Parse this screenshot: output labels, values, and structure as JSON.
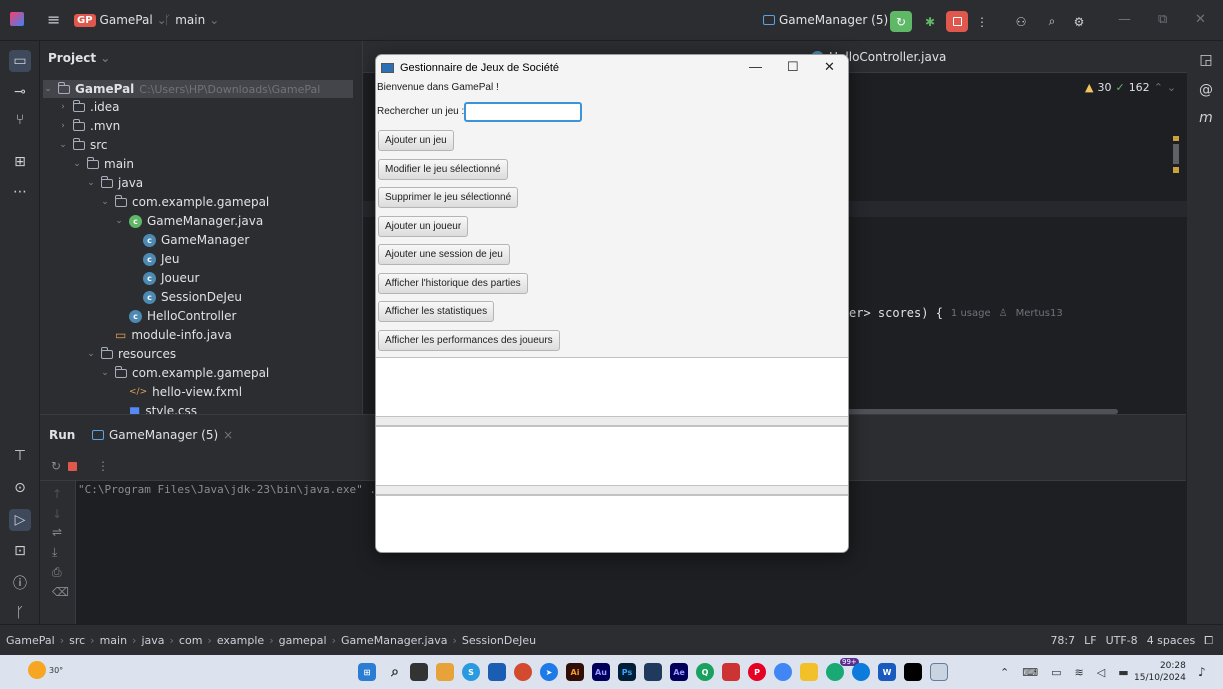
{
  "titlebar": {
    "project_badge": "GP",
    "project_name": "GamePal",
    "branch": "main",
    "run_config": "GameManager (5)"
  },
  "project_panel": {
    "title": "Project",
    "root": {
      "name": "GamePal",
      "path": "C:\\Users\\HP\\Downloads\\GamePal"
    },
    "items": [
      {
        "label": ".idea",
        "kind": "folder",
        "depth": 1,
        "expanded": false
      },
      {
        "label": ".mvn",
        "kind": "folder",
        "depth": 1,
        "expanded": false
      },
      {
        "label": "src",
        "kind": "folder",
        "depth": 1,
        "expanded": true
      },
      {
        "label": "main",
        "kind": "folder",
        "depth": 2,
        "expanded": true
      },
      {
        "label": "java",
        "kind": "folder",
        "depth": 3,
        "expanded": true
      },
      {
        "label": "com.example.gamepal",
        "kind": "package",
        "depth": 4,
        "expanded": true
      },
      {
        "label": "GameManager.java",
        "kind": "javafile",
        "depth": 5,
        "expanded": true
      },
      {
        "label": "GameManager",
        "kind": "class",
        "depth": 6
      },
      {
        "label": "Jeu",
        "kind": "class",
        "depth": 6
      },
      {
        "label": "Joueur",
        "kind": "class",
        "depth": 6
      },
      {
        "label": "SessionDeJeu",
        "kind": "class",
        "depth": 6
      },
      {
        "label": "HelloController",
        "kind": "class",
        "depth": 5
      },
      {
        "label": "module-info.java",
        "kind": "module",
        "depth": 4
      },
      {
        "label": "resources",
        "kind": "resfolder",
        "depth": 3,
        "expanded": true
      },
      {
        "label": "com.example.gamepal",
        "kind": "folder",
        "depth": 4,
        "expanded": true
      },
      {
        "label": "hello-view.fxml",
        "kind": "fxml",
        "depth": 5
      },
      {
        "label": "style.css",
        "kind": "css",
        "depth": 5
      }
    ]
  },
  "editor": {
    "visible_tab": "HelloController.java",
    "warnings": "30",
    "checks": "162",
    "code_fragment": "er> scores) {",
    "usage_hint": "1 usage",
    "author_hint": "Mertus13"
  },
  "run_panel": {
    "label": "Run",
    "tab": "GameManager (5)",
    "console_line": "\"C:\\Program Files\\Java\\jdk-23\\bin\\java.exe\" ..."
  },
  "statusbar": {
    "breadcrumb": [
      "GamePal",
      "src",
      "main",
      "java",
      "com",
      "example",
      "gamepal",
      "GameManager.java",
      "SessionDeJeu"
    ],
    "position": "78:7",
    "line_sep": "LF",
    "encoding": "UTF-8",
    "indent": "4 spaces"
  },
  "dialog": {
    "title": "Gestionnaire de Jeux de Société",
    "welcome": "Bienvenue dans GamePal !",
    "search_label": "Rechercher un jeu :",
    "search_value": "",
    "buttons": [
      "Ajouter un jeu",
      "Modifier le jeu sélectionné",
      "Supprimer le jeu sélectionné",
      "Ajouter un joueur",
      "Ajouter une session de jeu",
      "Afficher l'historique des parties",
      "Afficher les statistiques",
      "Afficher les performances des joueurs"
    ]
  },
  "taskbar": {
    "weather": "30°",
    "time": "20:28",
    "date": "15/10/2024",
    "notif_badge": "99+"
  },
  "colors": {
    "ide_bg": "#1e1f22",
    "ide_panel": "#2b2d30",
    "accent_green": "#5fb865",
    "accent_red": "#e0584d",
    "focus_blue": "#3d93d8"
  }
}
